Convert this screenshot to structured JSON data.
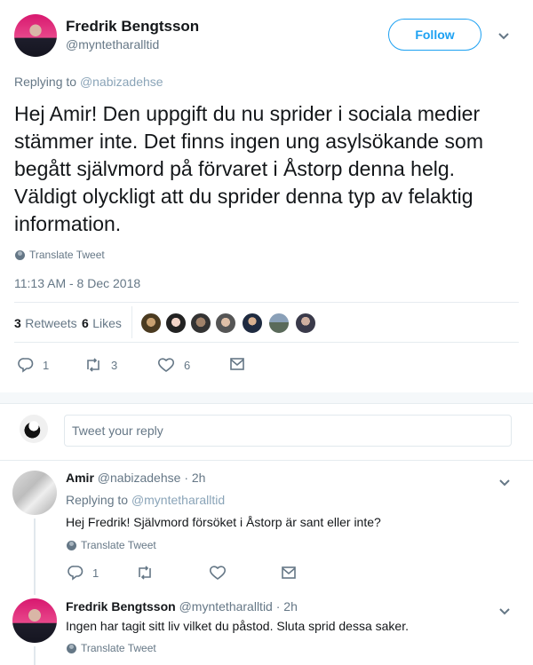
{
  "main_tweet": {
    "author_name": "Fredrik Bengtsson",
    "author_handle": "@myntetharalltid",
    "follow_label": "Follow",
    "replying_prefix": "Replying to",
    "replying_handle": "@nabizadehse",
    "text": "Hej Amir! Den uppgift du nu sprider i sociala medier stämmer inte. Det finns ingen ung asylsökande som begått självmord på förvaret i Åstorp denna helg. Väldigt olyckligt att du sprider denna typ av felaktig information.",
    "translate_label": "Translate Tweet",
    "timestamp": "11:13 AM - 8 Dec 2018",
    "retweets_count": "3",
    "retweets_label": "Retweets",
    "likes_count": "6",
    "likes_label": "Likes",
    "actions": {
      "reply_count": "1",
      "retweet_count": "3",
      "like_count": "6"
    }
  },
  "reply_composer": {
    "placeholder": "Tweet your reply"
  },
  "replies": [
    {
      "author_name": "Amir",
      "author_handle": "@nabizadehse",
      "time": "· 2h",
      "replying_prefix": "Replying to",
      "replying_handle": "@myntetharalltid",
      "text": "Hej Fredrik! Självmord försöket i Åstorp är sant eller inte?",
      "translate_label": "Translate Tweet",
      "reply_count": "1"
    },
    {
      "author_name": "Fredrik Bengtsson",
      "author_handle": "@myntetharalltid",
      "time": "· 2h",
      "text": "Ingen har tagit sitt liv vilket du påstod. Sluta sprid dessa saker.",
      "translate_label": "Translate Tweet"
    }
  ],
  "colors": {
    "accent": "#1da1f2",
    "muted": "#657786",
    "text": "#14171a",
    "border": "#e6ecf0"
  },
  "icons": [
    "reply-icon",
    "retweet-icon",
    "heart-icon",
    "message-icon",
    "chevron-down-icon",
    "globe-icon"
  ]
}
